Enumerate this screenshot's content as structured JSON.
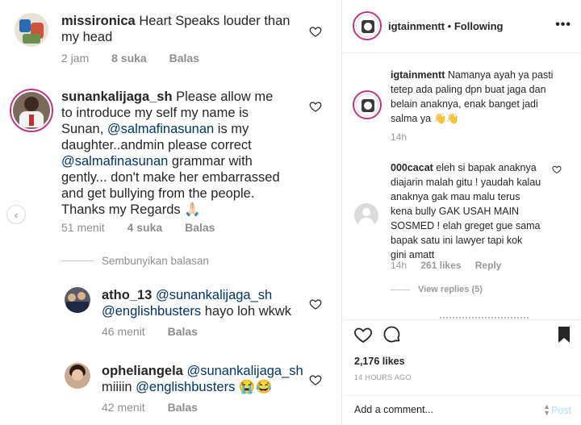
{
  "left_panel": {
    "comments": [
      {
        "username": "missironica",
        "text": "Heart Speaks louder than my head",
        "time": "2 jam",
        "likes": "8 suka",
        "reply_label": "Balas"
      },
      {
        "username": "sunankalijaga_sh",
        "text_line1": "Please allow me",
        "text_line2": "to introduce my self my name is",
        "text_line3a": "Sunan, ",
        "text_line3_mention": "@salmafinasunan",
        "text_line3b": " is my",
        "text_line4": "daughter..andmin please correct",
        "text_line5_mention": "@salmafinasunan",
        "text_line5b": " grammar with",
        "text_line6": "gently... don't make her embarrassed",
        "text_line7": "and get bullying from the people.",
        "text_line8": "Thanks my Regards 🙏🏻",
        "time": "51 menit",
        "likes": "4 suka",
        "reply_label": "Balas"
      }
    ],
    "hide_replies": "Sembunyikan balasan",
    "replies": [
      {
        "username": "atho_13",
        "mention1": "@sunankalijaga_sh",
        "mention2": "@englishbusters",
        "text": " hayo loh wkwk",
        "time": "46 menit",
        "reply_label": "Balas"
      },
      {
        "username": "opheliangela",
        "mention1": "@sunankalijaga_sh",
        "text_prefix": "miiiin ",
        "mention2": "@englishbusters",
        "emoji": " 😭😂",
        "time": "42 menit",
        "reply_label": "Balas"
      }
    ]
  },
  "right_panel": {
    "header": {
      "username": "igtainmentt",
      "separator": " • ",
      "following": "Following",
      "more": "•••"
    },
    "caption": {
      "username": "igtainmentt",
      "line1": " Namanya ayah ya pasti",
      "line2": "tetep ada paling dpn buat jaga dan",
      "line3": "belain anaknya, enak banget jadi",
      "line4": "salma ya 👋👋",
      "time": "14h"
    },
    "comment": {
      "username": "000cacat",
      "line1": " eleh si bapak anaknya",
      "line2": "diajarin malah gitu ! yaudah kalau",
      "line3": "anaknya gak mau malu terus",
      "line4": "kena bully GAK USAH MAIN",
      "line5": "SOSMED ! elah greget gue sama",
      "line6": "bapak satu ini lawyer tapi kok",
      "line7": "gini amatt",
      "time": "14h",
      "likes": "261 likes",
      "reply_label": "Reply",
      "view_replies": "View replies (5)"
    },
    "likes": "2,176 likes",
    "timestamp": "14 HOURS AGO",
    "add_comment_placeholder": "Add a comment...",
    "post_label": "Post"
  },
  "colors": {
    "link": "#003569",
    "muted": "#8e8e8e",
    "post_disabled": "#b2dffc",
    "story_ring": "#c13584"
  }
}
